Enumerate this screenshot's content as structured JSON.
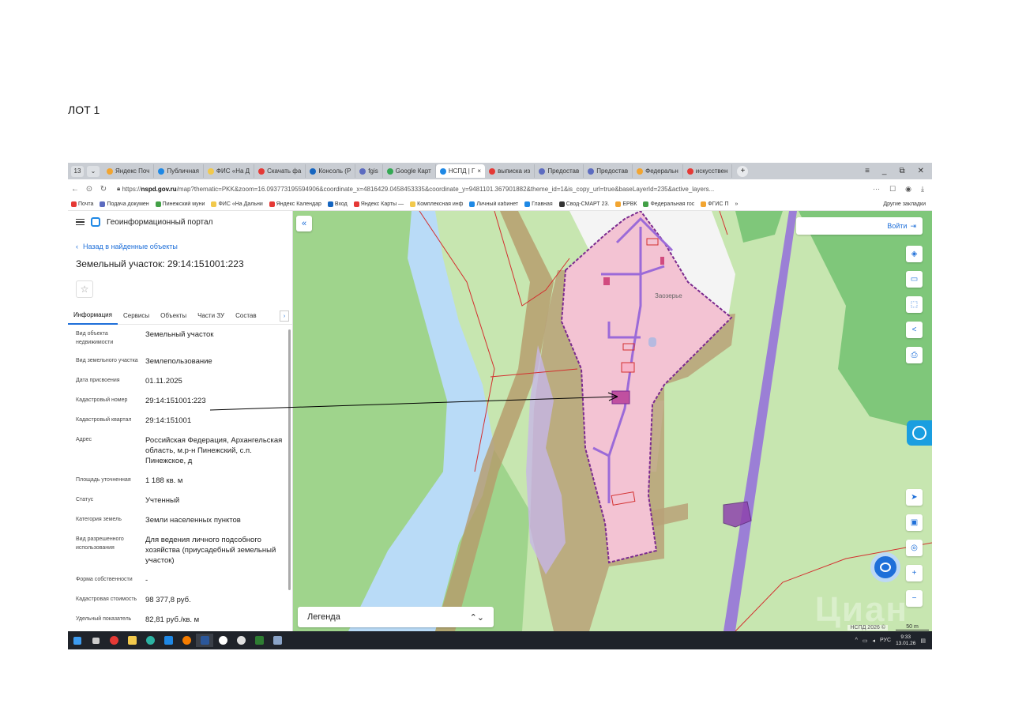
{
  "document": {
    "title": "ЛОТ 1"
  },
  "browser": {
    "tab_count": "13",
    "tabs": [
      {
        "label": "Яндекс Поч",
        "color": "#f2a531"
      },
      {
        "label": "Публичная",
        "color": "#1e88e5"
      },
      {
        "label": "ФИС «На Д",
        "color": "#f2c94c"
      },
      {
        "label": "Скачать фа",
        "color": "#e53935"
      },
      {
        "label": "Консоль (Р",
        "color": "#1565c0"
      },
      {
        "label": "fgis",
        "color": "#5c6bc0"
      },
      {
        "label": "Google Карт",
        "color": "#34a853"
      },
      {
        "label": "НСПД | Г",
        "color": "#1e88e5",
        "active": true
      },
      {
        "label": "выписка из",
        "color": "#e53935"
      },
      {
        "label": "Предостав",
        "color": "#5c6bc0"
      },
      {
        "label": "Предостав",
        "color": "#5c6bc0"
      },
      {
        "label": "Федеральн",
        "color": "#f2a531"
      },
      {
        "label": "искусствен",
        "color": "#e53935"
      }
    ],
    "url_prefix": "https://",
    "url_host": "nspd.gov.ru",
    "url_rest": "/map?thematic=PKK&zoom=16.093773195594906&coordinate_x=4816429.0458453335&coordinate_y=9481101.367901882&theme_id=1&is_copy_url=true&baseLayerId=235&active_layers...",
    "bookmarks": [
      {
        "label": "Почта",
        "color": "#e53935"
      },
      {
        "label": "Подача докумен",
        "color": "#5c6bc0"
      },
      {
        "label": "Пинежский муни",
        "color": "#43a047"
      },
      {
        "label": "ФИС «На Дальни",
        "color": "#f2c94c"
      },
      {
        "label": "Яндекс Календар",
        "color": "#e53935"
      },
      {
        "label": "Вход",
        "color": "#1565c0"
      },
      {
        "label": "Яндекс Карты —",
        "color": "#e53935"
      },
      {
        "label": "Комплексная инф",
        "color": "#f2c94c"
      },
      {
        "label": "Личный кабинет",
        "color": "#1e88e5"
      },
      {
        "label": "Главная",
        "color": "#1e88e5"
      },
      {
        "label": "Свод-СМАРТ 23.",
        "color": "#333333"
      },
      {
        "label": "ЕРВК",
        "color": "#f2a531"
      },
      {
        "label": "Федеральная гос",
        "color": "#43a047"
      },
      {
        "label": "ФГИС П",
        "color": "#f2a531"
      }
    ],
    "bookmarks_more": "»",
    "other_bookmarks": "Другие закладки"
  },
  "portal": {
    "name": "Геоинформационный портал",
    "back_link": "Назад в найденные объекты",
    "object_title": "Земельный участок: 29:14:151001:223",
    "tabs": [
      "Информация",
      "Сервисы",
      "Объекты",
      "Части ЗУ",
      "Состав"
    ],
    "attributes": [
      {
        "label": "Вид объекта недвижимости",
        "value": "Земельный участок"
      },
      {
        "label": "Вид земельного участка",
        "value": "Землепользование"
      },
      {
        "label": "Дата присвоения",
        "value": "01.11.2025"
      },
      {
        "label": "Кадастровый номер",
        "value": "29:14:151001:223"
      },
      {
        "label": "Кадастровый квартал",
        "value": "29:14:151001"
      },
      {
        "label": "Адрес",
        "value": "Российская Федерация, Архангельская область, м.р-н Пинежский, с.п. Пинежское, д"
      },
      {
        "label": "Площадь уточненная",
        "value": "1 188 кв. м"
      },
      {
        "label": "Статус",
        "value": "Учтенный"
      },
      {
        "label": "Категория земель",
        "value": "Земли населенных пунктов"
      },
      {
        "label": "Вид разрешенного использования",
        "value": "Для ведения личного подсобного хозяйства (приусадебный земельный участок)"
      },
      {
        "label": "Форма собственности",
        "value": "-"
      },
      {
        "label": "Кадастровая стоимость",
        "value": "98 377,8 руб."
      },
      {
        "label": "Удельный показатель",
        "value": "82,81 руб./кв. м"
      }
    ]
  },
  "map": {
    "login_label": "Войти",
    "village_label": "Заозерье",
    "legend_label": "Легенда",
    "attribution": "НСПД 2026 ©",
    "scale_label": "50 m",
    "watermark": "Циан"
  },
  "taskbar": {
    "language": "РУС",
    "time": "9:33",
    "date": "13.01.26"
  },
  "colors": {
    "parcel_fill": "#f3c3d3",
    "parcel_border": "#7b2a8f",
    "road": "#9b6ad8",
    "river": "#b9dbf7",
    "forest": "#7fc77a",
    "accent": "#1e6fd9"
  }
}
